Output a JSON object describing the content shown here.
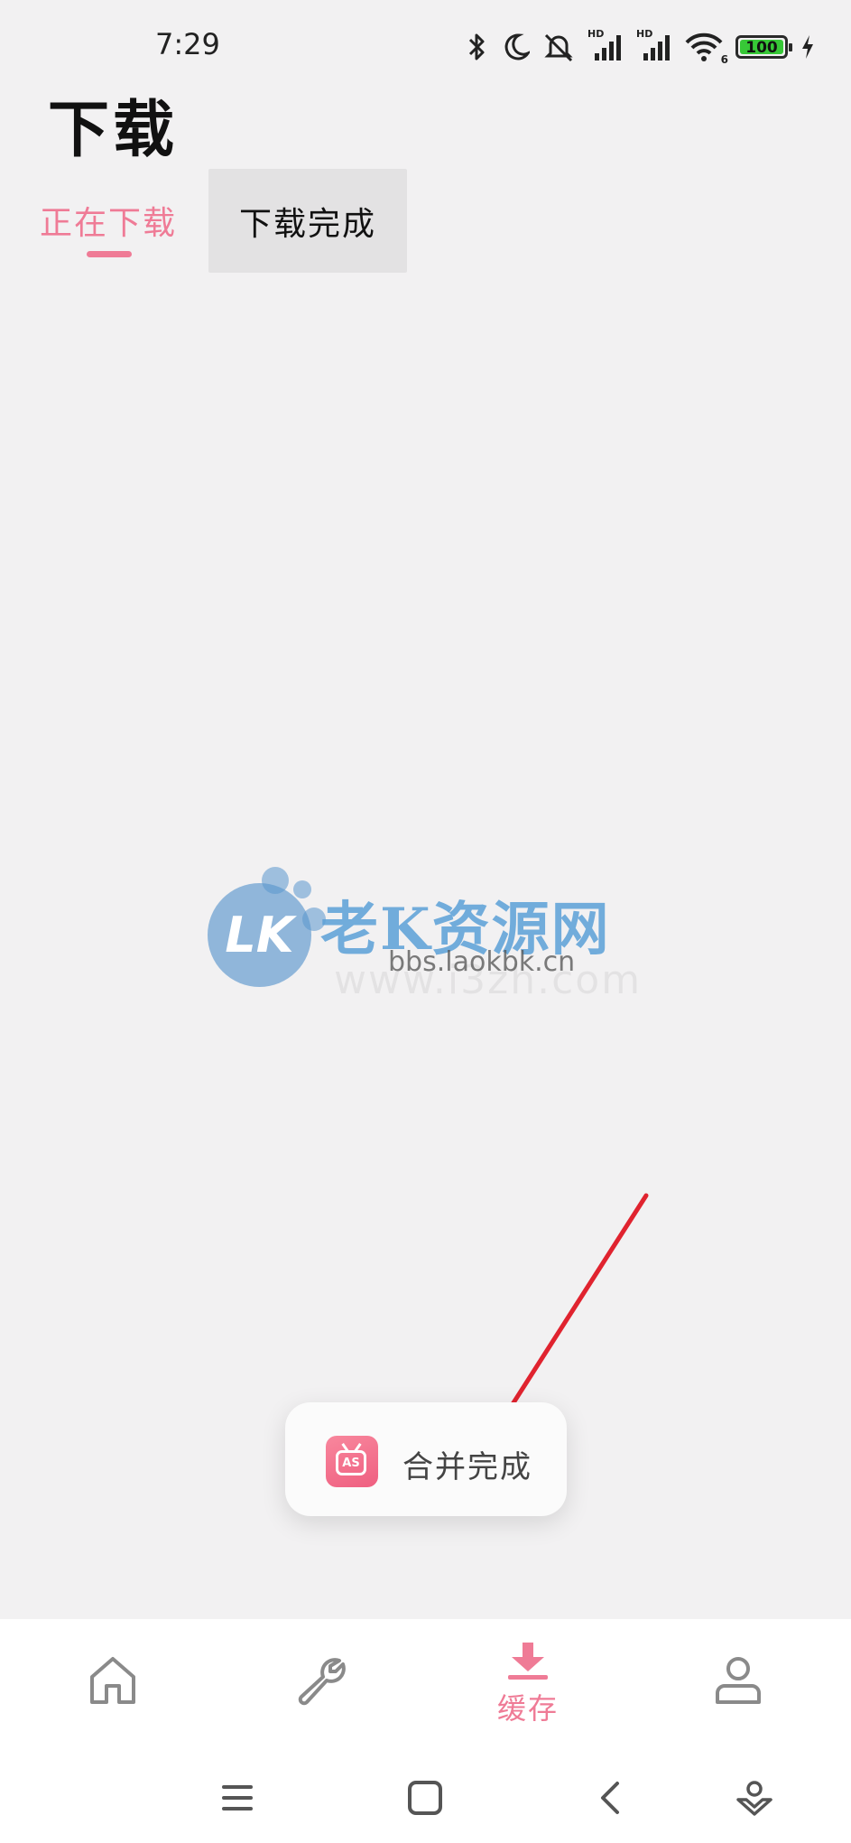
{
  "status_bar": {
    "time": "7:29",
    "signal1_label": "HD",
    "signal2_label": "HD",
    "wifi_label": "6",
    "battery": "100",
    "icons": [
      "bluetooth-icon",
      "moon-icon",
      "mute-icon",
      "signal-icon",
      "signal-icon",
      "wifi-icon",
      "battery-icon",
      "charging-icon"
    ]
  },
  "page": {
    "title": "下载"
  },
  "tabs": [
    {
      "label": "正在下载",
      "active": true
    },
    {
      "label": "下载完成",
      "active": false
    }
  ],
  "watermark": {
    "logo": "LK",
    "title": "老K资源网",
    "url": "bbs.laokbk.cn",
    "faint_url": "www.i3zh.com"
  },
  "toast": {
    "text": "合并完成",
    "icon_text": "AS",
    "icon": "app-tv-icon"
  },
  "bottom_nav": {
    "items": [
      {
        "name": "home",
        "icon": "home-icon",
        "label": ""
      },
      {
        "name": "tools",
        "icon": "wrench-icon",
        "label": ""
      },
      {
        "name": "cache",
        "icon": "download-icon",
        "label": "缓存",
        "active": true
      },
      {
        "name": "profile",
        "icon": "user-icon",
        "label": ""
      }
    ]
  },
  "colors": {
    "accent": "#ef7b96",
    "background": "#f2f1f2",
    "annotation_arrow": "#e0232f"
  }
}
